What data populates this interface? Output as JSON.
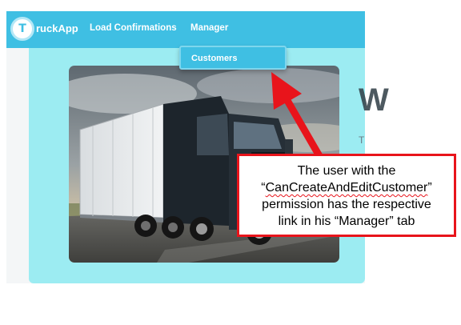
{
  "app": {
    "logo_letter": "T",
    "logo_rest": "ruckApp",
    "brand_color": "#3fbfe3"
  },
  "nav": {
    "items": [
      {
        "label": "Load Confirmations"
      },
      {
        "label": "Manager"
      }
    ]
  },
  "dropdown": {
    "items": [
      {
        "label": "Customers"
      }
    ]
  },
  "content": {
    "heading_fragment": "W",
    "text_fragment": "T",
    "image": "semi-truck photo"
  },
  "annotation": {
    "line1": "The user with the",
    "quote_open": "“",
    "permission": "CanCreateAndEditCustomer",
    "quote_close": "”",
    "line3": "permission has the respective",
    "line4": "link in his “Manager” tab",
    "border_color": "#e8141b",
    "arrow_color": "#e8141b"
  }
}
